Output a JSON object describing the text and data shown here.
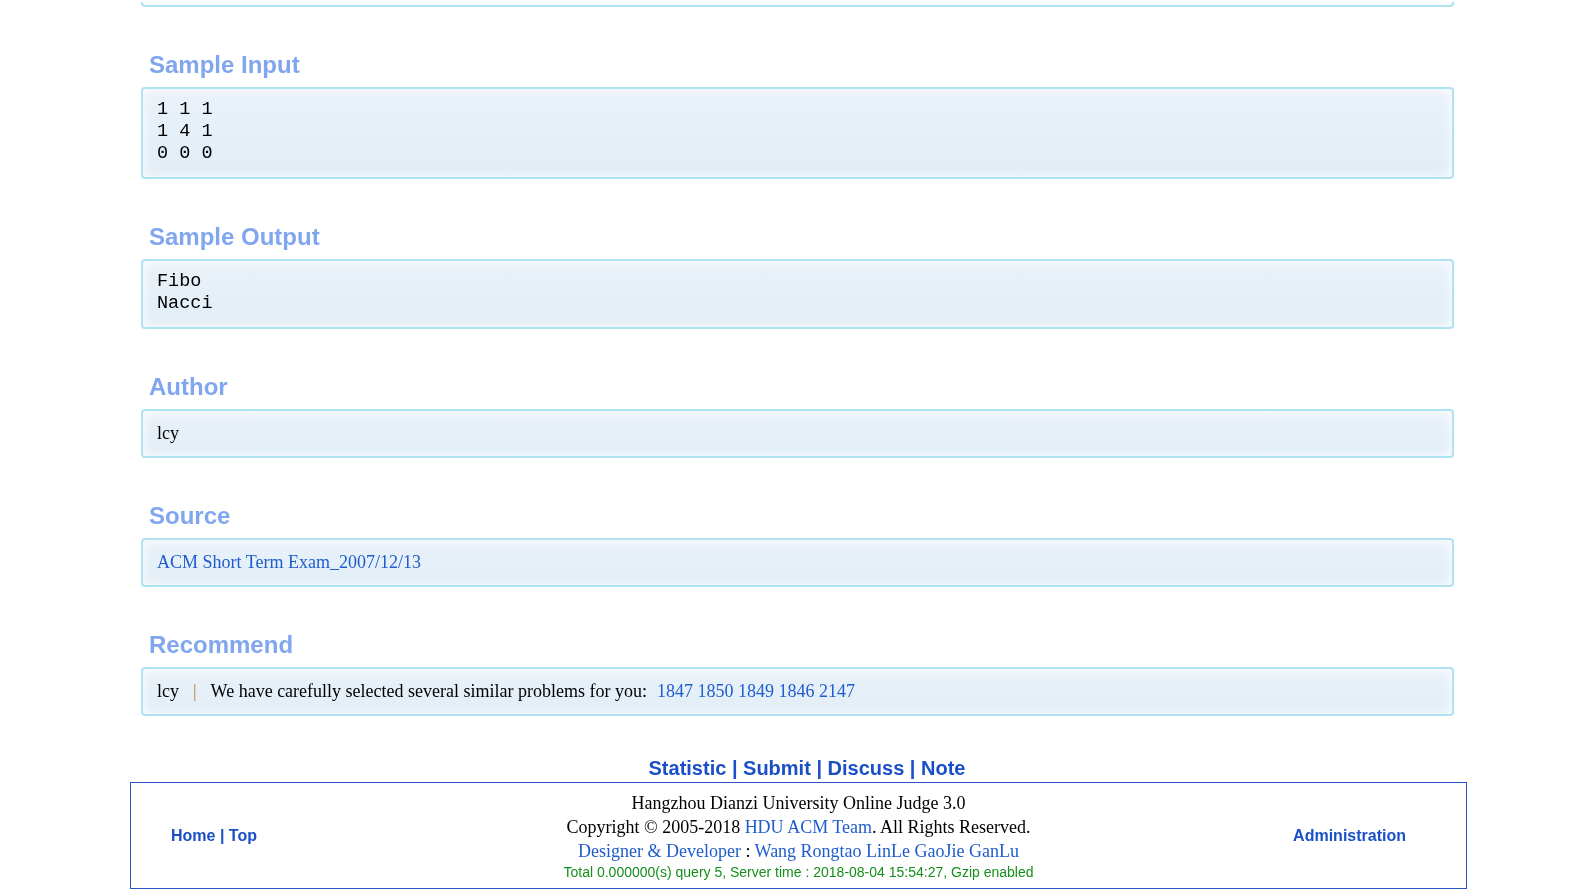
{
  "sections": [
    {
      "kind": "partial"
    },
    {
      "kind": "code",
      "heading": "Sample Input",
      "lines": [
        "1 1 1",
        "1 4 1",
        "0 0 0"
      ]
    },
    {
      "kind": "code",
      "heading": "Sample Output",
      "lines": [
        "Fibo",
        "Nacci"
      ]
    },
    {
      "kind": "text",
      "heading": "Author",
      "text": "lcy"
    },
    {
      "kind": "link",
      "heading": "Source",
      "text": "ACM Short Term Exam_2007/12/13"
    },
    {
      "kind": "recommend",
      "heading": "Recommend",
      "author": "lcy",
      "separator": "|",
      "text": "We have carefully selected several similar problems for you:",
      "problems": [
        "1847",
        "1850",
        "1849",
        "1846",
        "2147"
      ]
    }
  ],
  "nav_links": [
    "Statistic",
    "Submit",
    "Discuss",
    "Note"
  ],
  "nav_separator": "|",
  "footer": {
    "left_links": [
      "Home",
      "Top"
    ],
    "left_separator": "|",
    "title": "Hangzhou Dianzi University Online Judge 3.0",
    "copyright_before": "Copyright © 2005-2018",
    "copyright_link": "HDU ACM Team",
    "copyright_after": ". All Rights Reserved.",
    "designer_link": "Designer & Developer",
    "designer_sep": ":",
    "developers_link": "Wang Rongtao LinLe GaoJie GanLu",
    "stats": "Total 0.000000(s) query 5, Server time : 2018-08-04 15:54:27, Gzip enabled",
    "right_link": "Administration"
  }
}
